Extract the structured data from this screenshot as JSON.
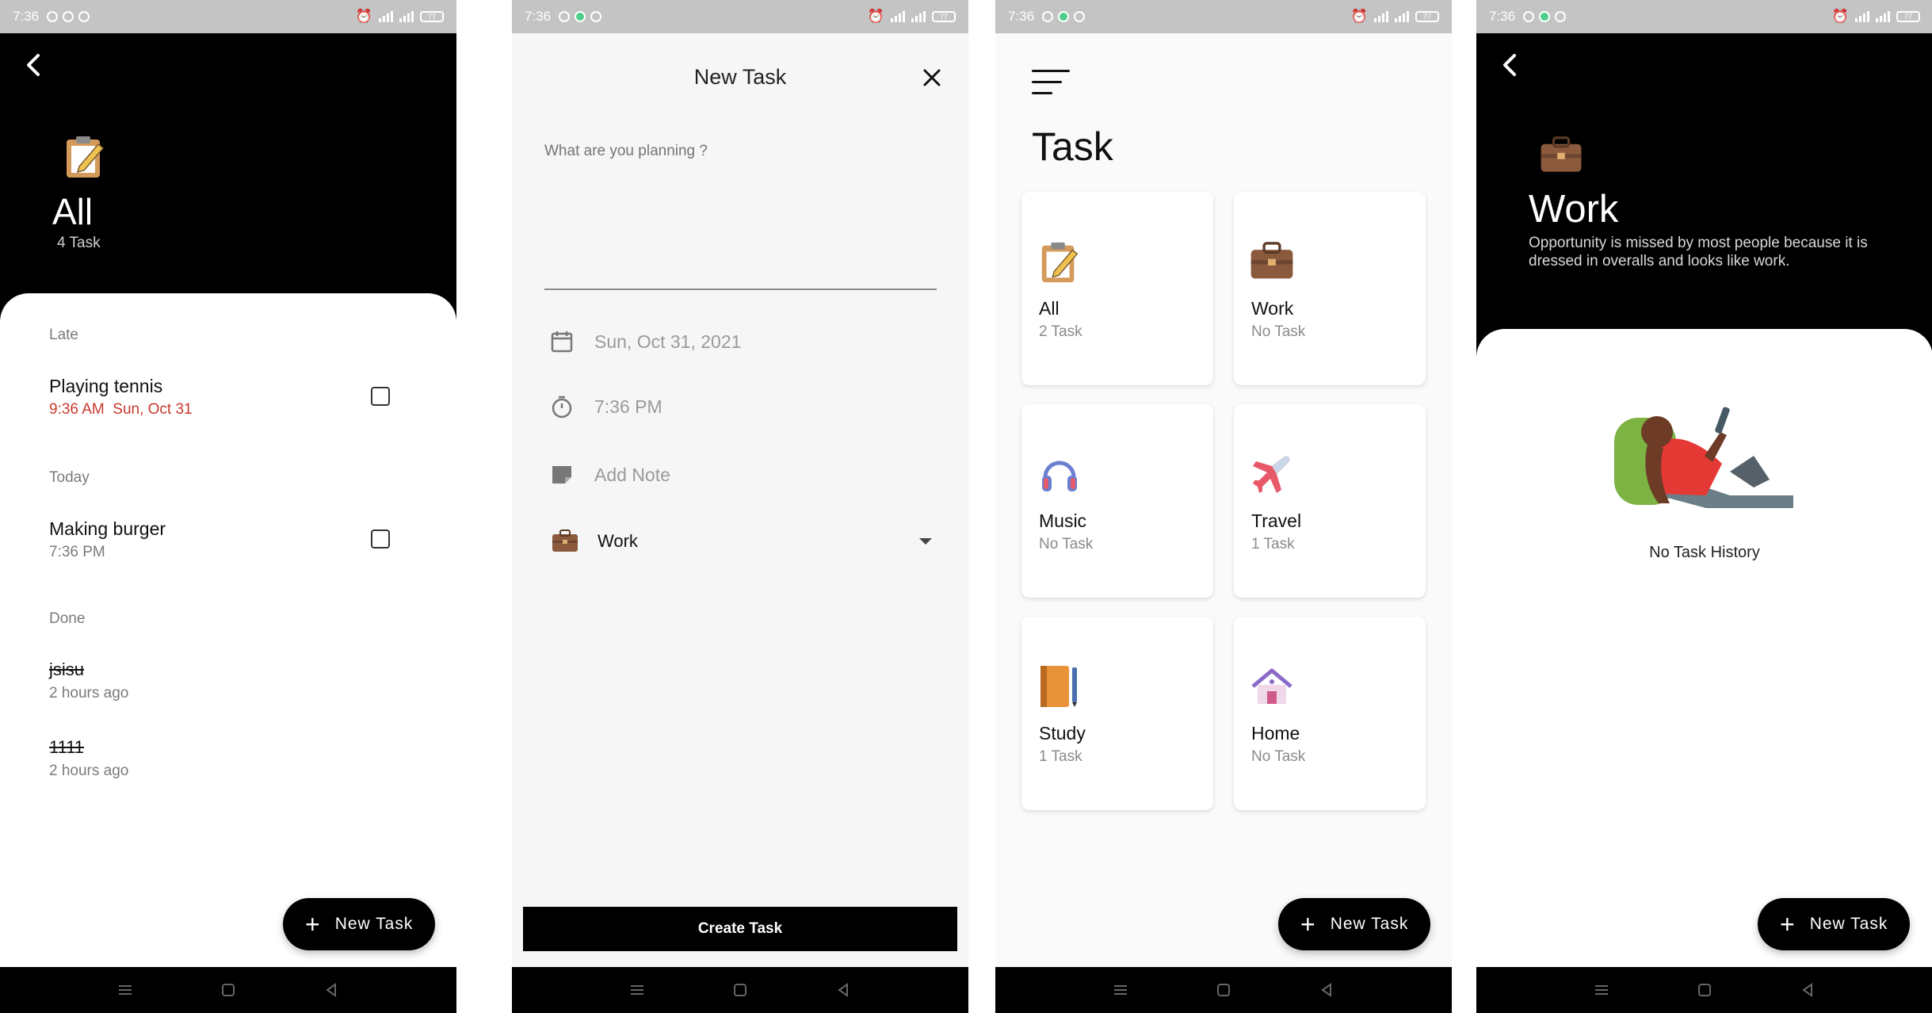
{
  "status_bar": {
    "time": "7:36",
    "battery": "77"
  },
  "screen_all": {
    "title": "All",
    "count": "4 Task",
    "sections": [
      {
        "label": "Late",
        "tasks": [
          {
            "title": "Playing tennis",
            "time": "9:36 AM",
            "date": "Sun, Oct 31"
          }
        ]
      },
      {
        "label": "Today",
        "tasks": [
          {
            "title": "Making burger",
            "time": "7:36 PM"
          }
        ]
      },
      {
        "label": "Done",
        "tasks": [
          {
            "title": "jsisu",
            "meta": "2 hours ago"
          },
          {
            "title": "1111",
            "meta": "2 hours ago"
          }
        ]
      }
    ],
    "fab_label": "New Task"
  },
  "screen_new_task": {
    "title": "New Task",
    "input_placeholder": "What are you planning ?",
    "date": "Sun, Oct 31, 2021",
    "time": "7:36 PM",
    "note_label": "Add Note",
    "category": "Work",
    "create_label": "Create Task"
  },
  "screen_categories": {
    "heading": "Task",
    "cards": [
      {
        "name": "All",
        "count": "2 Task",
        "icon": "clipboard-icon"
      },
      {
        "name": "Work",
        "count": "No Task",
        "icon": "briefcase-icon"
      },
      {
        "name": "Music",
        "count": "No Task",
        "icon": "headphones-icon"
      },
      {
        "name": "Travel",
        "count": "1 Task",
        "icon": "airplane-icon"
      },
      {
        "name": "Study",
        "count": "1 Task",
        "icon": "notebook-icon"
      },
      {
        "name": "Home",
        "count": "No Task",
        "icon": "house-icon"
      }
    ],
    "fab_label": "New Task"
  },
  "screen_work": {
    "title": "Work",
    "quote": " Opportunity is missed by most people because it is dressed in overalls and looks like work.",
    "empty_text": "No Task History",
    "fab_label": "New Task"
  },
  "colors": {
    "accent": "#000000",
    "late": "#c9392e",
    "muted": "#7a7a7a",
    "status_bar": "#c4c4c4"
  }
}
